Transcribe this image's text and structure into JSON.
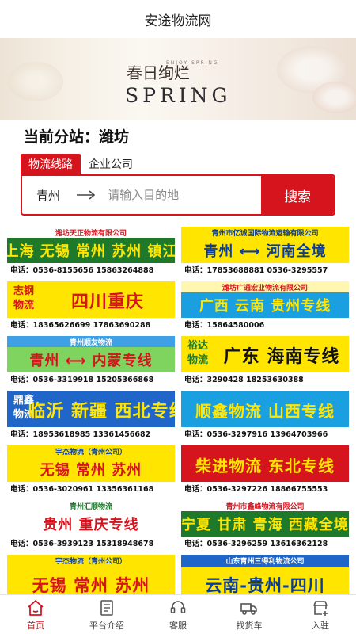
{
  "app": {
    "title": "安途物流网"
  },
  "banner": {
    "cn": "春日绚烂",
    "sub": "ENJOY SPRING",
    "en": "SPRING"
  },
  "station": {
    "label": "当前分站：潍坊"
  },
  "tabs": [
    {
      "label": "物流线路",
      "active": true
    },
    {
      "label": "企业公司",
      "active": false
    }
  ],
  "search": {
    "origin": "青州",
    "placeholder": "请输入目的地",
    "button": "搜索"
  },
  "ads": [
    {
      "top": "潍坊天正物流有限公司",
      "main": "上海 无锡 常州 苏州 镇江",
      "phone": "电话：0536-8155656  15863264888",
      "side": ""
    },
    {
      "top": "青州市亿诚国际物流运输有限公司",
      "main": "青州 ⟷ 河南全境",
      "phone": "电话：17853688881  0536-3295557",
      "side": ""
    },
    {
      "top": "",
      "main": "四川重庆",
      "phone": "电话：18365626699  17863690288",
      "side": "志钢物流"
    },
    {
      "top": "潍坊广通宏业物流有限公司",
      "main": "广西 云南 贵州专线",
      "phone": "电话：15864580006",
      "side": ""
    },
    {
      "top": "青州顺友物流",
      "main": "青州 ⟷ 内蒙专线",
      "phone": "电话：0536-3319918  15205366868",
      "side": ""
    },
    {
      "top": "",
      "main": "广东 海南专线",
      "phone": "电话：3290428  18253630388",
      "side": "裕达物流"
    },
    {
      "top": "",
      "main": "临沂 新疆 西北专线",
      "phone": "电话：18953618985  13361456682",
      "side": "鼎鑫物流"
    },
    {
      "top": "",
      "main": "顺鑫物流  山西专线",
      "phone": "电话：0536-3297916  13964703966",
      "side": ""
    },
    {
      "top": "宇杰物流（青州公司）",
      "main": "无锡 常州 苏州",
      "phone": "电话：0536-3020961  13356361168",
      "side": ""
    },
    {
      "top": "",
      "main": "柴进物流 东北专线",
      "phone": "电话：0536-3297226  18866755553",
      "side": ""
    },
    {
      "top": "青州汇顺物流",
      "main": "贵州 重庆专线",
      "phone": "电话：0536-3939123  15318948678",
      "side": ""
    },
    {
      "top": "青州市鑫峰物流有限公司",
      "main": "宁夏 甘肃 青海 西藏全境",
      "phone": "电话：0536-3296259  13616362128",
      "side": ""
    },
    {
      "top": "宇杰物流（青州公司）",
      "main": "无锡 常州 苏州",
      "phone": "",
      "side": ""
    },
    {
      "top": "山东青州三得利物流公司",
      "main": "云南-贵州-四川",
      "phone": "",
      "side": ""
    }
  ],
  "tabbar": [
    {
      "label": "首页",
      "icon": "home-icon",
      "active": true
    },
    {
      "label": "平台介绍",
      "icon": "document-icon",
      "active": false
    },
    {
      "label": "客服",
      "icon": "headset-icon",
      "active": false
    },
    {
      "label": "找货车",
      "icon": "truck-icon",
      "active": false
    },
    {
      "label": "入驻",
      "icon": "store-plus-icon",
      "active": false
    }
  ],
  "colors": {
    "accent": "#d6141e"
  }
}
